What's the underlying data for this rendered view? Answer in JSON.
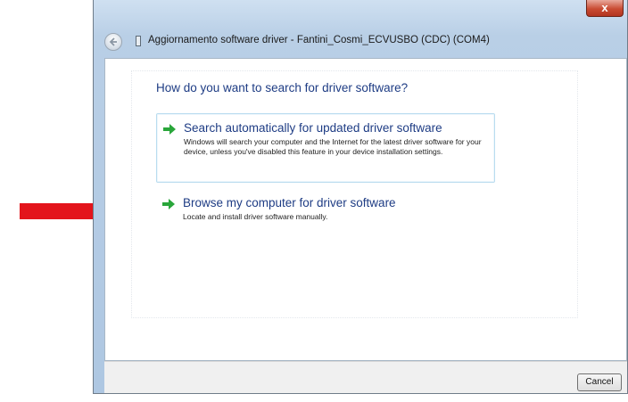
{
  "window": {
    "close_label": "x",
    "title": "Aggiornamento software driver - Fantini_Cosmi_ECVUSBO (CDC) (COM4)"
  },
  "main": {
    "question": "How do you want to search for driver software?",
    "options": [
      {
        "title": "Search automatically for updated driver software",
        "description": "Windows will search your computer and the Internet for the latest driver software for your device, unless you've disabled this feature in your device installation settings.",
        "icon": "green-arrow-icon"
      },
      {
        "title": "Browse my computer for driver software",
        "description": "Locate and install driver software manually.",
        "icon": "green-arrow-icon"
      }
    ]
  },
  "footer": {
    "cancel_label": "Cancel"
  },
  "annotation": {
    "icon": "red-arrow-icon",
    "color": "#e3141b"
  },
  "colors": {
    "link_blue": "#1e3c84",
    "arrow_green": "#29a63a",
    "close_red": "#c94c33"
  }
}
